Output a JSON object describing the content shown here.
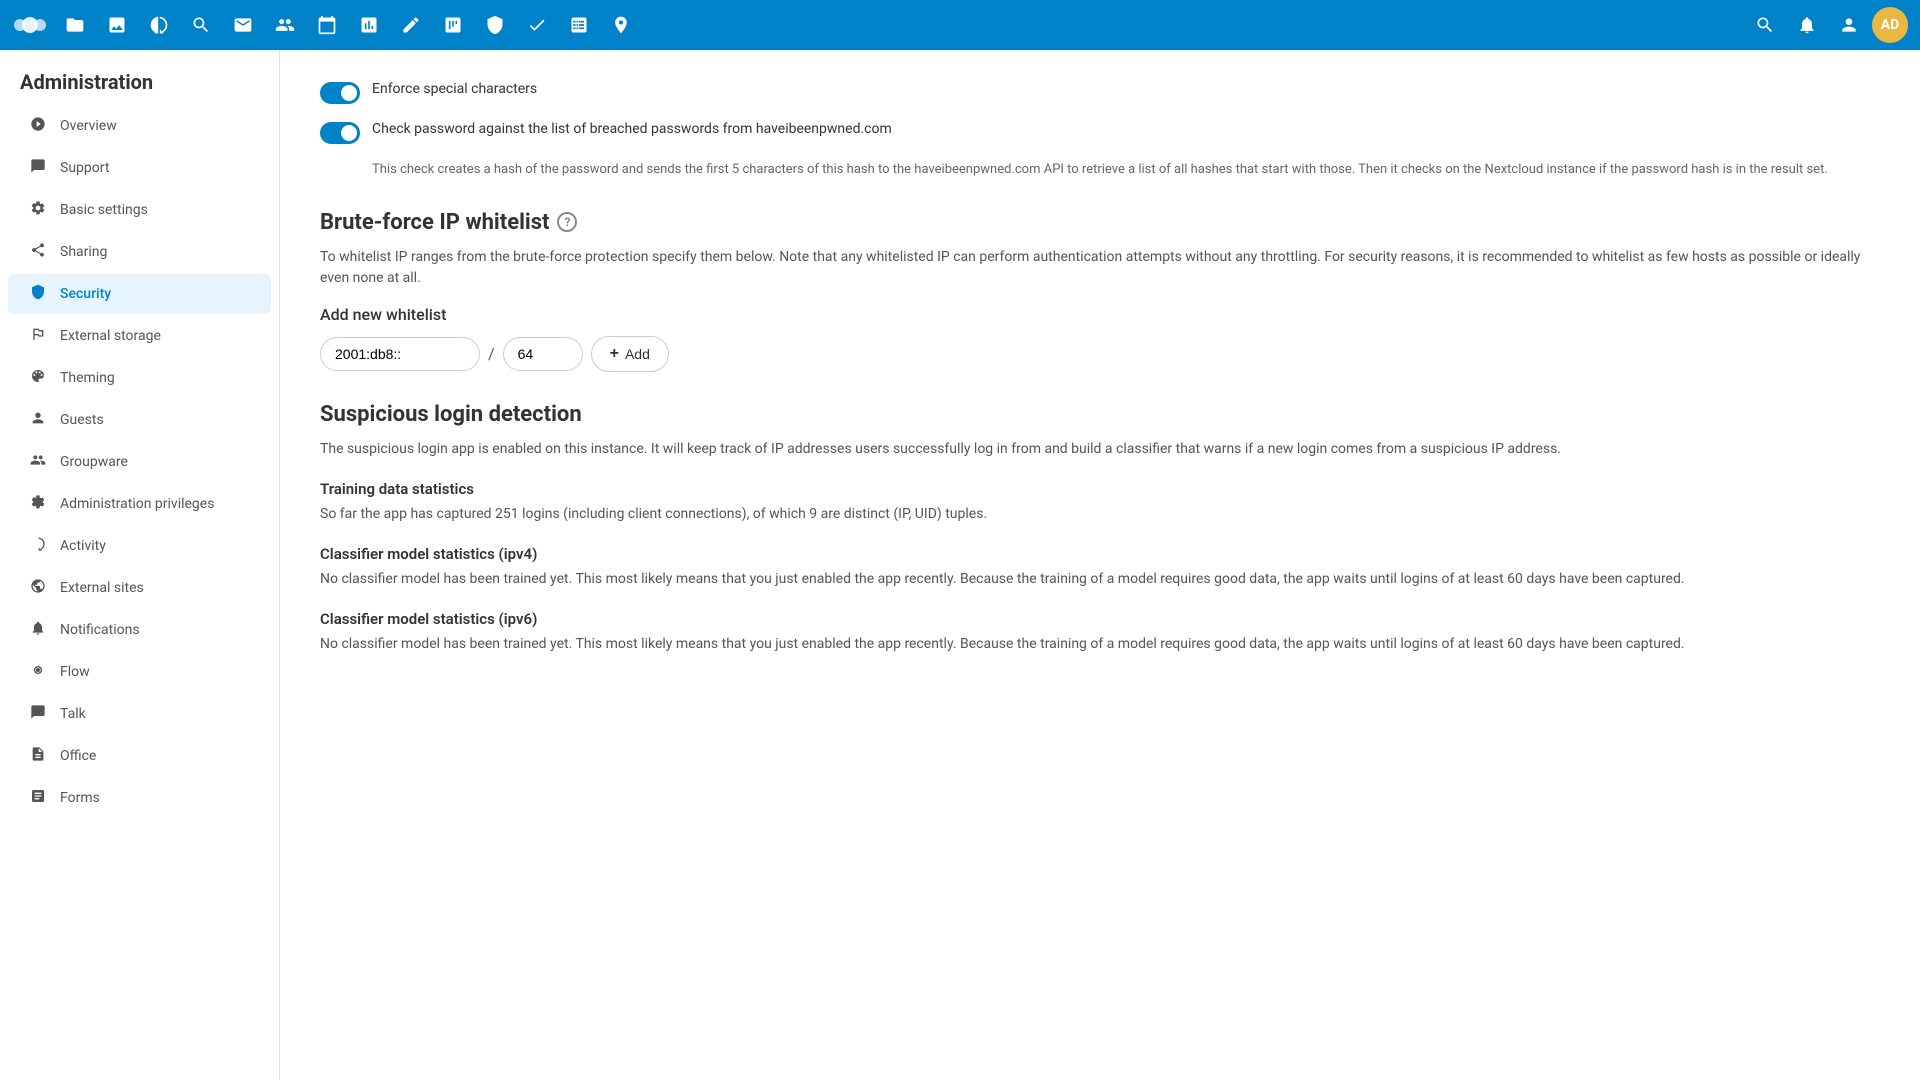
{
  "app": {
    "title": "Nextcloud",
    "logo_text": "○○○"
  },
  "topbar": {
    "icons": [
      "○",
      "📁",
      "🖼",
      "⚡",
      "🔍",
      "✉",
      "👥",
      "📅",
      "📊",
      "✏",
      "📦",
      "✦",
      "☰",
      "✓",
      "⊞",
      "📍"
    ],
    "right_icons": [
      "🔍",
      "🔔",
      "👤"
    ],
    "avatar_initials": "AD"
  },
  "sidebar": {
    "title": "Administration",
    "items": [
      {
        "id": "overview",
        "label": "Overview",
        "icon": "○"
      },
      {
        "id": "support",
        "label": "Support",
        "icon": "💬"
      },
      {
        "id": "basic-settings",
        "label": "Basic settings",
        "icon": "⚙"
      },
      {
        "id": "sharing",
        "label": "Sharing",
        "icon": "↗"
      },
      {
        "id": "security",
        "label": "Security",
        "icon": "🔒",
        "active": true
      },
      {
        "id": "external-storage",
        "label": "External storage",
        "icon": "↗"
      },
      {
        "id": "theming",
        "label": "Theming",
        "icon": "🎨"
      },
      {
        "id": "guests",
        "label": "Guests",
        "icon": "👤"
      },
      {
        "id": "groupware",
        "label": "Groupware",
        "icon": "👥"
      },
      {
        "id": "admin-privileges",
        "label": "Administration privileges",
        "icon": "⚙"
      },
      {
        "id": "activity",
        "label": "Activity",
        "icon": "⚡"
      },
      {
        "id": "external-sites",
        "label": "External sites",
        "icon": "🌐"
      },
      {
        "id": "notifications",
        "label": "Notifications",
        "icon": "🔔"
      },
      {
        "id": "flow",
        "label": "Flow",
        "icon": "◎"
      },
      {
        "id": "talk",
        "label": "Talk",
        "icon": "💬"
      },
      {
        "id": "office",
        "label": "Office",
        "icon": "📄"
      },
      {
        "id": "forms",
        "label": "Forms",
        "icon": "📋"
      }
    ]
  },
  "content": {
    "toggle1": {
      "label": "Enforce special characters",
      "enabled": true
    },
    "toggle2": {
      "label": "Check password against the list of breached passwords from haveibeenpwned.com",
      "enabled": true,
      "description": "This check creates a hash of the password and sends the first 5 characters of this hash to the haveibeenpwned.com API to retrieve a list of all hashes that start with those. Then it checks on the Nextcloud instance if the password hash is in the result set."
    },
    "brute_force_section": {
      "title": "Brute-force IP whitelist",
      "description": "To whitelist IP ranges from the brute-force protection specify them below. Note that any whitelisted IP can perform authentication attempts without any throttling. For security reasons, it is recommended to whitelist as few hosts as possible or ideally even none at all.",
      "add_new_label": "Add new whitelist",
      "ip_placeholder": "2001:db8::",
      "mask_placeholder": "64",
      "add_button_label": "Add"
    },
    "suspicious_login_section": {
      "title": "Suspicious login detection",
      "intro": "The suspicious login app is enabled on this instance. It will keep track of IP addresses users successfully log in from and build a classifier that warns if a new login comes from a suspicious IP address.",
      "training_data": {
        "title": "Training data statistics",
        "text": "So far the app has captured 251 logins (including client connections), of which 9 are distinct (IP, UID) tuples."
      },
      "classifier_ipv4": {
        "title": "Classifier model statistics (ipv4)",
        "text": "No classifier model has been trained yet. This most likely means that you just enabled the app recently. Because the training of a model requires good data, the app waits until logins of at least 60 days have been captured."
      },
      "classifier_ipv6": {
        "title": "Classifier model statistics (ipv6)",
        "text": "No classifier model has been trained yet. This most likely means that you just enabled the app recently. Because the training of a model requires good data, the app waits until logins of at least 60 days have been captured."
      }
    }
  }
}
